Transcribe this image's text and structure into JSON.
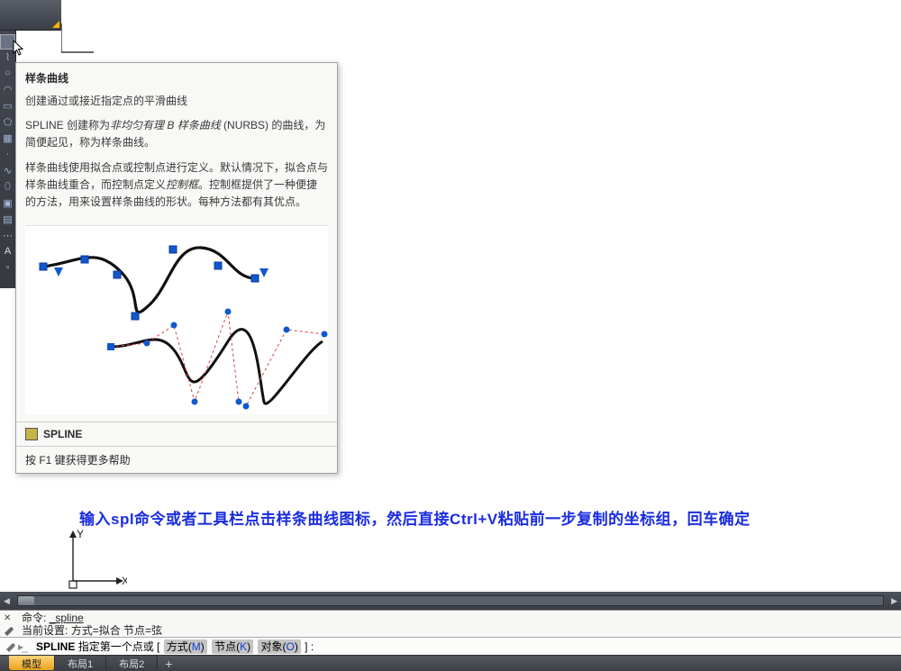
{
  "tooltip": {
    "title": "样条曲线",
    "subtitle": "创建通过或接近指定点的平滑曲线",
    "para1_lead": "SPLINE 创建称为",
    "para1_italic": "非均匀有理 B 样条曲线",
    "para1_tail": " (NURBS) 的曲线，为简便起见，称为样条曲线。",
    "para2_lead": "样条曲线使用拟合点或控制点进行定义。默认情况下，拟合点与样条曲线重合，而控制点定义",
    "para2_italic": "控制框",
    "para2_tail": "。控制框提供了一种便捷的方法，用来设置样条曲线的形状。每种方法都有其优点。",
    "command": "SPLINE",
    "f1_hint": "按 F1 键获得更多帮助"
  },
  "instruction": "输入spl命令或者工具栏点击样条曲线图标，然后直接Ctrl+V粘贴前一步复制的坐标组，回车确定",
  "ucs": {
    "x": "X",
    "y": "Y"
  },
  "cmdline": {
    "line1_label": "命令:",
    "line1_value": "_spline",
    "line2_label": "当前设置:",
    "line2_value": "方式=拟合   节点=弦",
    "prompt_cmd": "SPLINE",
    "prompt_text": "指定第一个点或",
    "opt_method": "方式",
    "opt_method_key": "M",
    "opt_knot": "节点",
    "opt_knot_key": "K",
    "opt_object": "对象",
    "opt_object_key": "O",
    "bracket_open": " [",
    "bracket_close": "] :",
    "lp": "(",
    "rp": ")"
  },
  "tabs": {
    "t1": "模型",
    "t2": "布局1",
    "t3": "布局2",
    "add": "+"
  }
}
